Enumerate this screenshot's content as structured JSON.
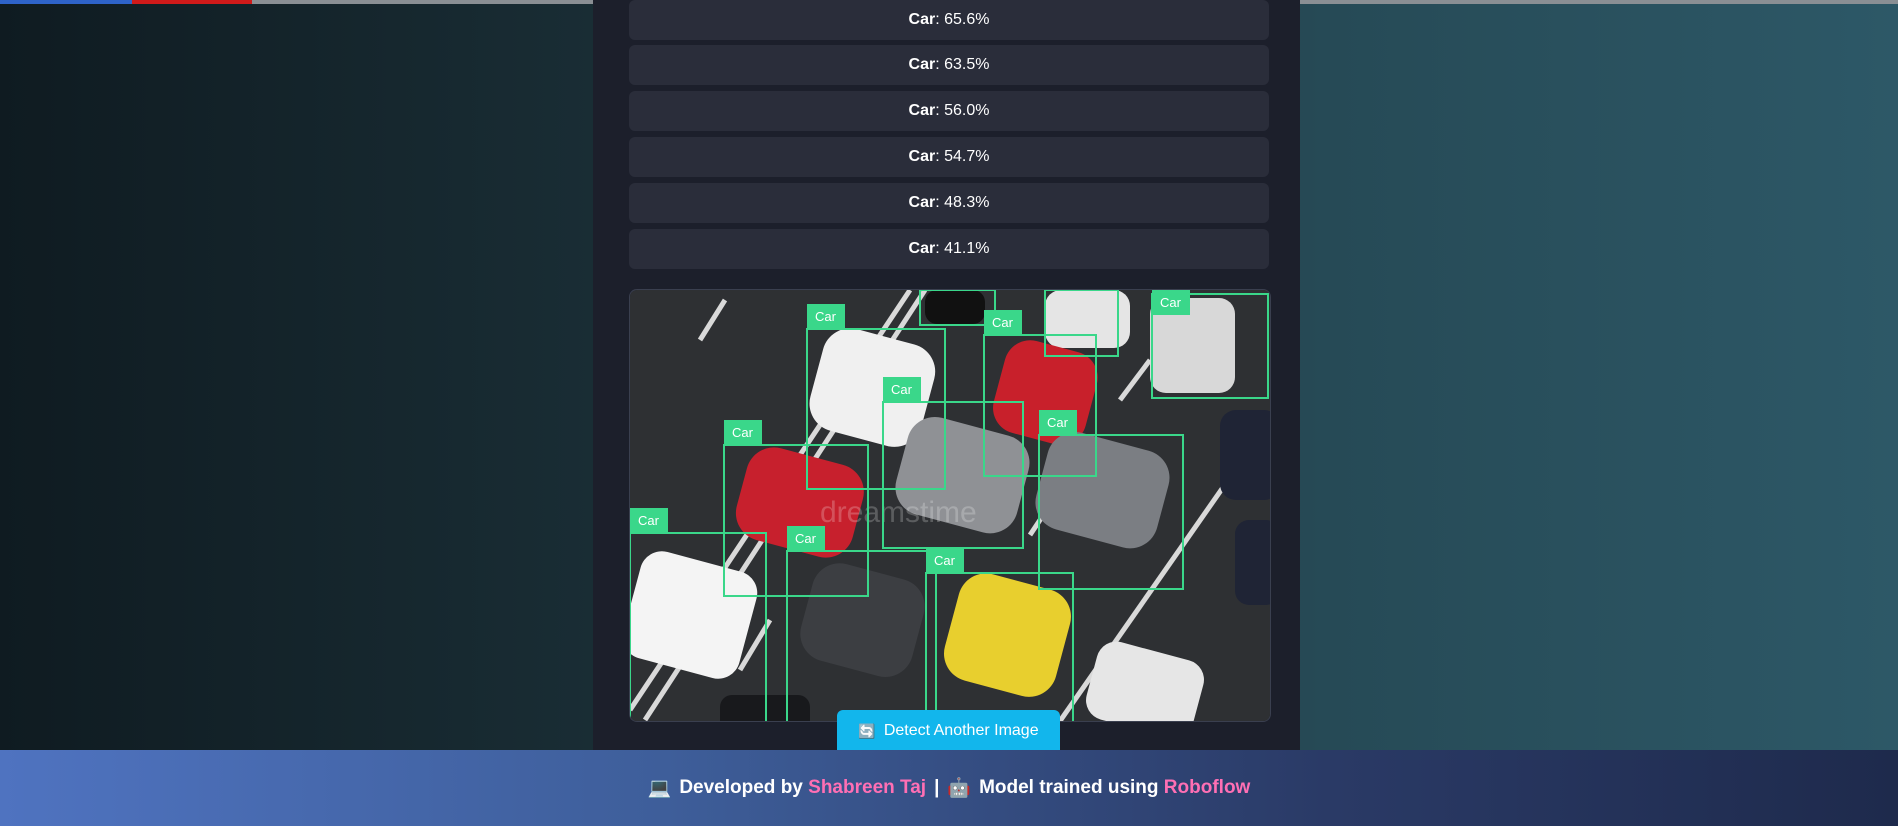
{
  "results": [
    {
      "label": "Car",
      "value": ": 65.6%"
    },
    {
      "label": "Car",
      "value": ": 63.5%"
    },
    {
      "label": "Car",
      "value": ": 56.0%"
    },
    {
      "label": "Car",
      "value": ": 54.7%"
    },
    {
      "label": "Car",
      "value": ": 48.3%"
    },
    {
      "label": "Car",
      "value": ": 41.1%"
    }
  ],
  "detection": {
    "box_label": "Car",
    "box_color": "#3ad78a",
    "watermark": "dreamstime"
  },
  "detect_button": {
    "icon": "refresh-icon",
    "label": "Detect Another Image"
  },
  "footer": {
    "laptop_icon": "💻",
    "developed_by": "Developed by",
    "developer": "Shabreen Taj",
    "separator": "|",
    "robot_icon": "🤖",
    "trained_text": "Model trained using",
    "platform": "Roboflow"
  },
  "colors": {
    "accent": "#12b6ec",
    "highlight": "#ff6fb4",
    "box": "#3ad78a"
  }
}
